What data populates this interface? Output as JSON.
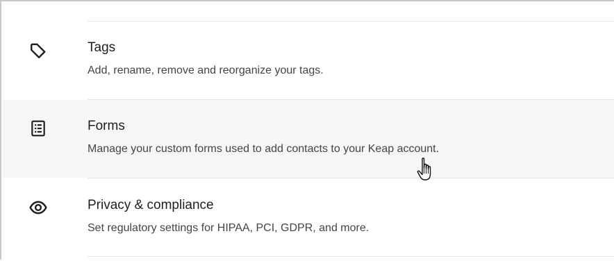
{
  "settings": {
    "items": [
      {
        "icon": "tag-icon",
        "title": "Tags",
        "description": "Add, rename, remove and reorganize your tags."
      },
      {
        "icon": "form-document-icon",
        "title": "Forms",
        "description": "Manage your custom forms used to add contacts to your Keap account."
      },
      {
        "icon": "eye-icon",
        "title": "Privacy & compliance",
        "description": "Set regulatory settings for HIPAA, PCI, GDPR, and more."
      }
    ]
  },
  "colors": {
    "hover_background": "#f6f6f6",
    "divider": "#e6e6e6",
    "title_text": "#1e1e1e",
    "description_text": "#444444",
    "frame_border": "#c7c7c7"
  },
  "cursor": "hand-pointer-icon"
}
